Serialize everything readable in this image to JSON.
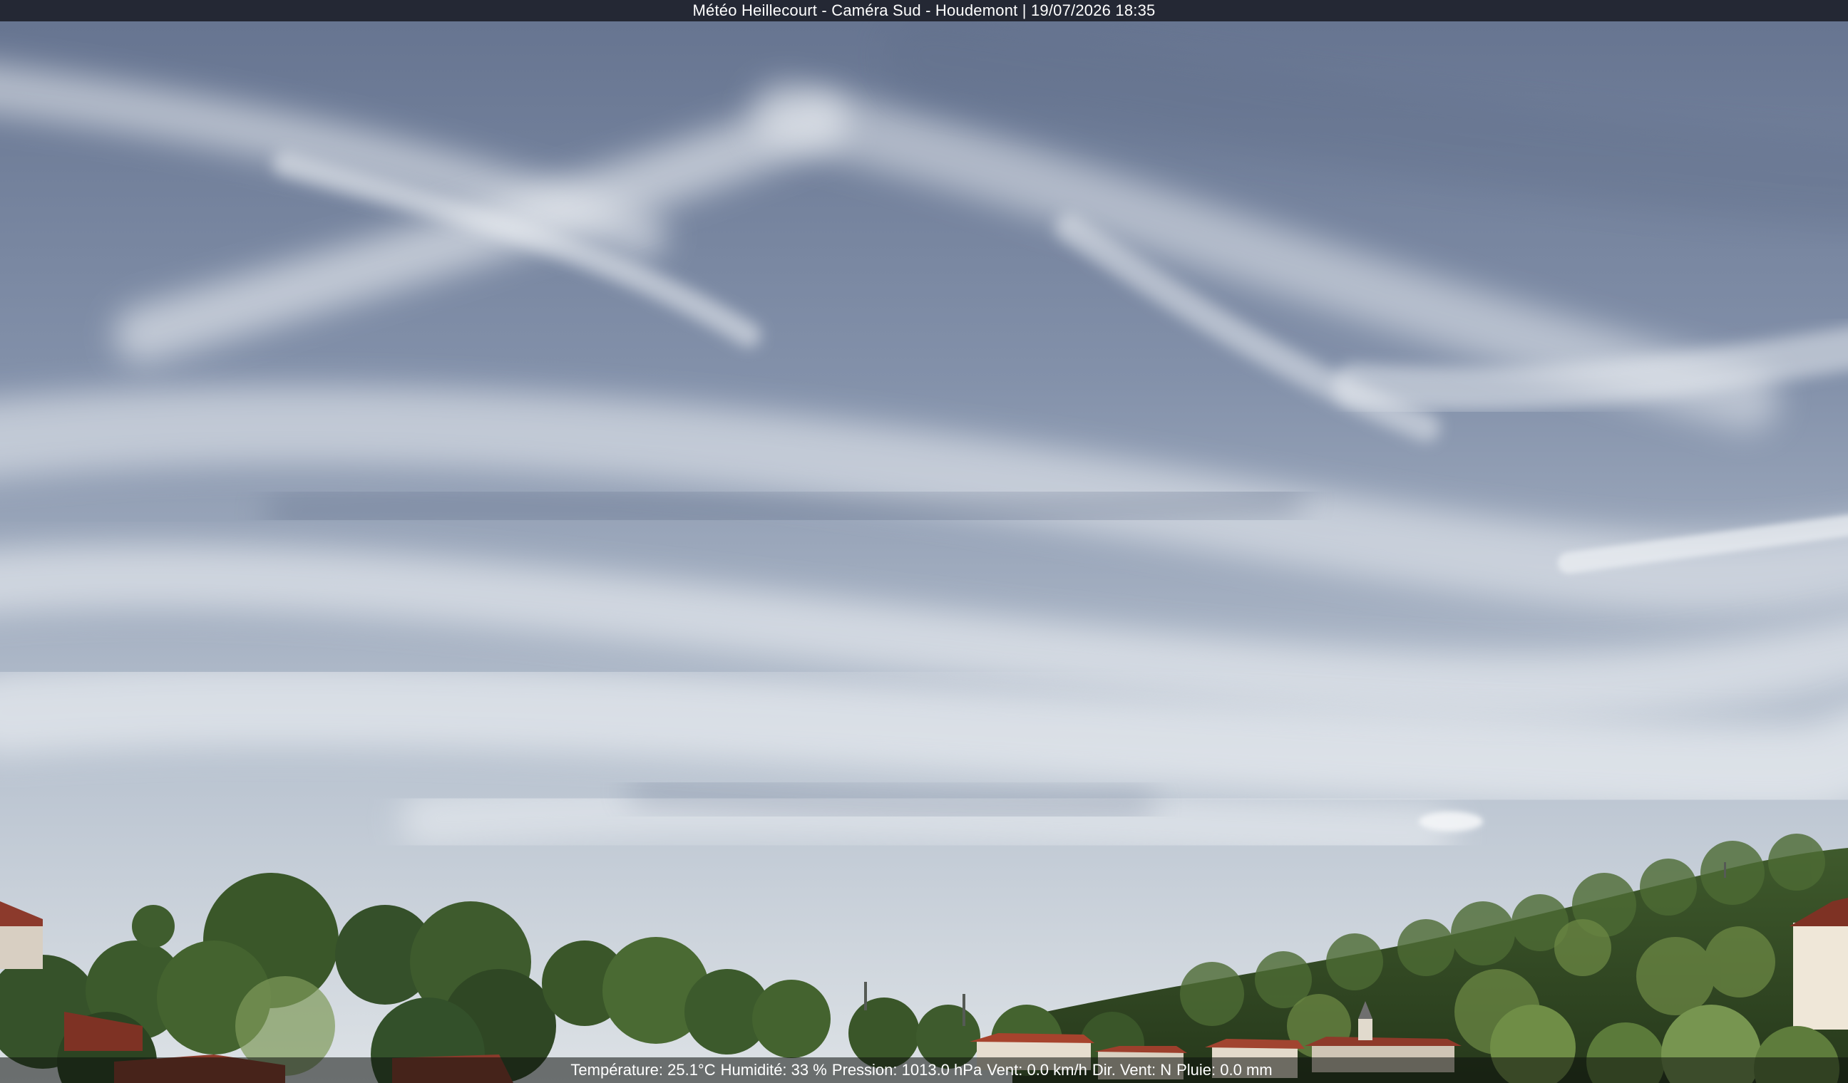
{
  "header": {
    "caption": "Météo Heillecourt - Caméra Sud - Houdemont | 19/07/2026 18:35"
  },
  "footer": {
    "temperature": "Température: 25.1°C",
    "humidity": "Humidité: 33 %",
    "pressure": "Pression: 1013.0 hPa",
    "wind_speed": "Vent: 0.0 km/h",
    "wind_direction": "Dir. Vent: N",
    "rain": "Pluie: 0.0 mm"
  },
  "colors": {
    "sky_top": "#6a7893",
    "sky_horizon": "#d9dfe4",
    "cloud": "#eef1f4",
    "foliage_dark": "#2f4a22",
    "foliage_light": "#7e9a52",
    "roof": "#8e3a2a"
  }
}
